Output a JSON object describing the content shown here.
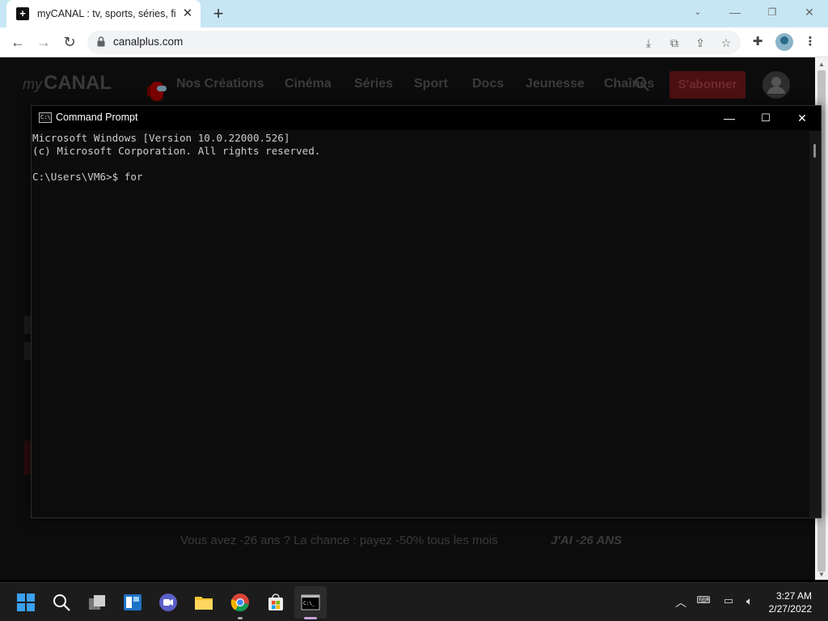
{
  "browser": {
    "tab_title": "myCANAL : tv, sports, séries, film",
    "favicon": "+",
    "url": "canalplus.com"
  },
  "site": {
    "logo_my": "my",
    "logo_canal": "CANAL",
    "nav": [
      "Nos Créations",
      "Cinéma",
      "Séries",
      "Sport",
      "Docs",
      "Jeunesse",
      "Chaînes"
    ],
    "subscribe_label": "S'abonner",
    "promo_text": "Vous avez -26 ans ? La chance : payez -50% tous les mois",
    "promo_cta": "J'AI -26 ANS"
  },
  "cmd": {
    "title": "Command Prompt",
    "icon_text": "C:\\",
    "lines": [
      "Microsoft Windows [Version 10.0.22000.526]",
      "(c) Microsoft Corporation. All rights reserved.",
      "",
      "C:\\Users\\VM6>$ for"
    ]
  },
  "taskbar": {
    "time": "3:27 AM",
    "date": "2/27/2022"
  },
  "colors": {
    "chrome_tabstrip": "#c7e6f4",
    "console_bg": "#0c0c0c",
    "console_text": "#cccccc",
    "subscribe_bg": "#4c0f12",
    "taskbar_bg": "#1c1c1c"
  }
}
